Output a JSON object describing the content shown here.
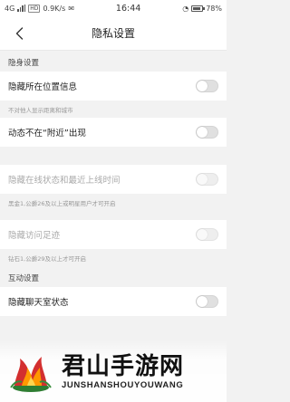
{
  "status_bar": {
    "left": "4G",
    "sim": "HD",
    "network_speed": "0.9K/s",
    "time": "16:44",
    "battery": "78%"
  },
  "header": {
    "title": "隐私设置",
    "back_icon": "chevron-left-icon"
  },
  "stealth_section": {
    "title": "隐身设置",
    "items": [
      {
        "label": "隐藏所在位置信息",
        "hint": "不对他人显示距离和城市",
        "on": false,
        "disabled": false
      },
      {
        "label": "动态不在“附近”出现",
        "hint": "",
        "on": false,
        "disabled": false
      },
      {
        "label": "隐藏在线状态和最近上线时间",
        "hint": "黑金1,公爵26及以上或明星用户才可开启",
        "on": false,
        "disabled": true
      },
      {
        "label": "隐藏访问足迹",
        "hint": "钻石1,公爵29及以上才可开启",
        "on": false,
        "disabled": true
      }
    ]
  },
  "interaction_section": {
    "title": "互动设置",
    "items": [
      {
        "label": "隐藏聊天室状态",
        "on": false,
        "disabled": false
      }
    ]
  },
  "watermark": {
    "title": "君山手游网",
    "subtitle": "JUNSHANSHOUYOUWANG",
    "partial_label": "态"
  }
}
